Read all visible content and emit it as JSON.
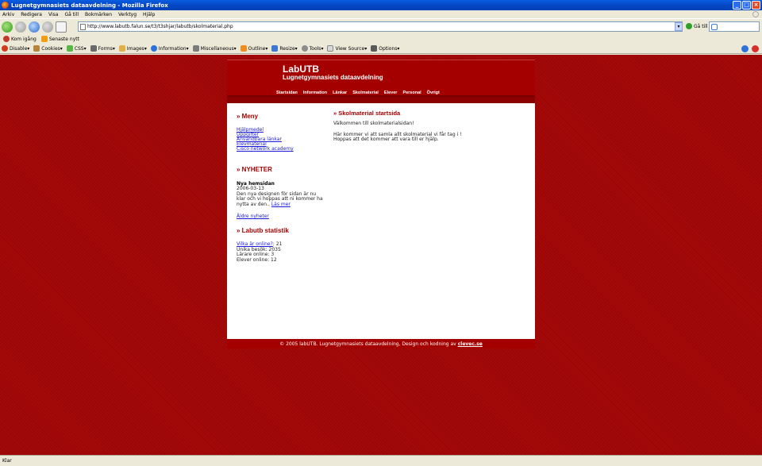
{
  "window": {
    "title": "Lugnetgymnasiets dataavdelning - Mozilla Firefox"
  },
  "menubar": {
    "items": [
      "Arkiv",
      "Redigera",
      "Visa",
      "Gå till",
      "Bokmärken",
      "Verktyg",
      "Hjälp"
    ]
  },
  "navbar": {
    "url": "http://www.labutb.falun.se/t3/t3shjar/labutb/skolmaterial.php",
    "go_label": "Gå till",
    "search_value": ""
  },
  "bookmarks": [
    "Kom igång",
    "Senaste nytt"
  ],
  "devtoolbar": [
    "Disable",
    "Cookies",
    "CSS",
    "Forms",
    "Images",
    "Information",
    "Miscellaneous",
    "Outline",
    "Resize",
    "Tools",
    "View Source",
    "Options"
  ],
  "site": {
    "title": "LabUTB",
    "subtitle": "Lugnetgymnasiets dataavdelning",
    "nav": [
      "Startsidan",
      "Information",
      "Länkar",
      "Skolmaterial",
      "Elever",
      "Personal",
      "Övrigt"
    ],
    "sidebar": {
      "menu_heading": "» Meny",
      "menu_links": [
        "Hjälpmedel",
        "Uppgifter",
        "Användbara länkar",
        "Elevmaterial",
        "Cisco network academy"
      ],
      "news_heading": "» NYHETER",
      "news_title": "Nya hemsidan",
      "news_date": "2006-03-13",
      "news_text": "Den nya designen för sidan är nu klar och vi hoppas att ni kommer ha nytta av den..",
      "news_more": "Läs mer",
      "old_news": "Äldre nyheter",
      "stats_heading": "» Labutb statistik",
      "stats_online_link": "Vilka är online?",
      "stats_online_value": ": 21",
      "stats_unique": "Unika besök: 2035",
      "stats_teachers": "Lärare online: 3",
      "stats_students": "Elever online: 12"
    },
    "main": {
      "heading": "» Skolmaterial startsida",
      "welcome": "Välkommen till skolmaterialsidan!",
      "line1": "Här kommer vi att samla allt skolmaterial vi får tag i !",
      "line2": "Hoppas att det kommer att vara till er hjälp."
    },
    "footer": {
      "text": "© 2005 labUTB. Lugnetgymnasiets dataavdelning, Design och kodning av",
      "link": "clevec.se"
    }
  },
  "statusbar": {
    "text": "Klar"
  }
}
